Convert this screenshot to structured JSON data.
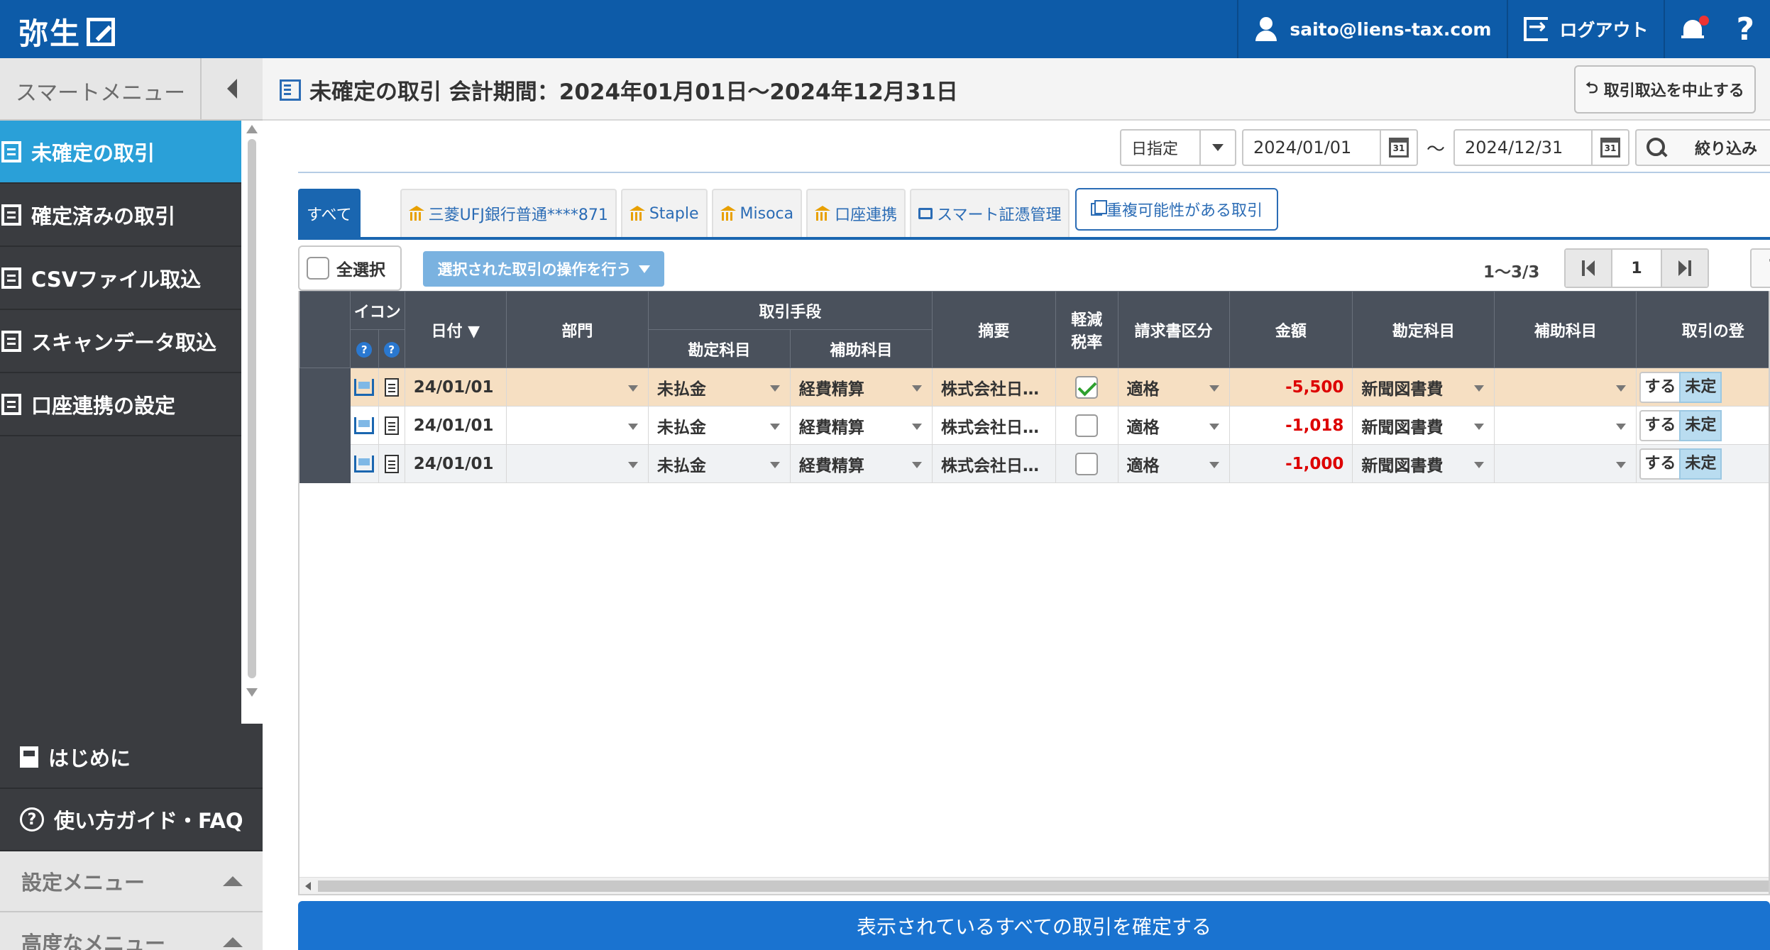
{
  "header": {
    "logo": "弥生",
    "user_email": "saito@liens-tax.com",
    "logout_label": "ログアウト",
    "help_label": "?"
  },
  "sidebar": {
    "title": "スマートメニュー",
    "items": [
      {
        "label": "未確定の取引",
        "active": true
      },
      {
        "label": "確定済みの取引"
      },
      {
        "label": "CSVファイル取込"
      },
      {
        "label": "スキャンデータ取込"
      },
      {
        "label": "口座連携の設定"
      }
    ],
    "bottom": [
      {
        "label": "はじめに"
      },
      {
        "label": "使い方ガイド・FAQ"
      }
    ],
    "settings_label": "設定メニュー",
    "advanced_label": "高度なメニュー"
  },
  "page": {
    "title": "未確定の取引 会計期間：2024年01月01日～2024年12月31日",
    "stop_import_label": "取引取込を中止する"
  },
  "filter": {
    "mode": "日指定",
    "date_from": "2024/01/01",
    "tilde": "～",
    "date_to": "2024/12/31",
    "search_label": "絞り込み",
    "cal_label": "31"
  },
  "tabs": [
    {
      "label": "すべて",
      "icon": "none"
    },
    {
      "label": "三菱UFJ銀行普通****871",
      "icon": "bank-icon"
    },
    {
      "label": "Staple",
      "icon": "bank-icon"
    },
    {
      "label": "Misoca",
      "icon": "bank-icon"
    },
    {
      "label": "口座連携",
      "icon": "bank-icon"
    },
    {
      "label": "スマート証憑管理",
      "icon": "print-icon"
    }
  ],
  "duplicate_label": "重複可能性がある取引",
  "toolbar": {
    "select_all": "全選択",
    "ops_label": "選択された取引の操作を行う",
    "count": "1～3/3",
    "page": "1",
    "refresh": "C"
  },
  "grid": {
    "headers": {
      "icon": "イコン",
      "date": "日付 ▼",
      "dept": "部門",
      "means": "取引手段",
      "means_account": "勘定科目",
      "means_sub": "補助科目",
      "summary": "摘要",
      "reduced_tax": "軽減\n税率",
      "invoice": "請求書区分",
      "amount": "金額",
      "account": "勘定科目",
      "sub": "補助科目",
      "action": "取引の登"
    },
    "rows": [
      {
        "date": "24/01/01",
        "dept": "",
        "means_account": "未払金",
        "means_sub": "経費精算",
        "summary": "株式会社日…",
        "reduced": true,
        "invoice": "適格",
        "amount": "-5,500",
        "account": "新聞図書費",
        "sub": "",
        "yes": "する",
        "no": "未定"
      },
      {
        "date": "24/01/01",
        "dept": "",
        "means_account": "未払金",
        "means_sub": "経費精算",
        "summary": "株式会社日…",
        "reduced": false,
        "invoice": "適格",
        "amount": "-1,018",
        "account": "新聞図書費",
        "sub": "",
        "yes": "する",
        "no": "未定"
      },
      {
        "date": "24/01/01",
        "dept": "",
        "means_account": "未払金",
        "means_sub": "経費精算",
        "summary": "株式会社日…",
        "reduced": false,
        "invoice": "適格",
        "amount": "-1,000",
        "account": "新聞図書費",
        "sub": "",
        "yes": "する",
        "no": "未定"
      }
    ]
  },
  "confirm_all_label": "表示されているすべての取引を確定する",
  "colors": {
    "brand": "#0d5ba8",
    "active_menu": "#2aa0d8",
    "highlight_row": "#f6dfc2",
    "negative_amount": "#dd0000"
  }
}
